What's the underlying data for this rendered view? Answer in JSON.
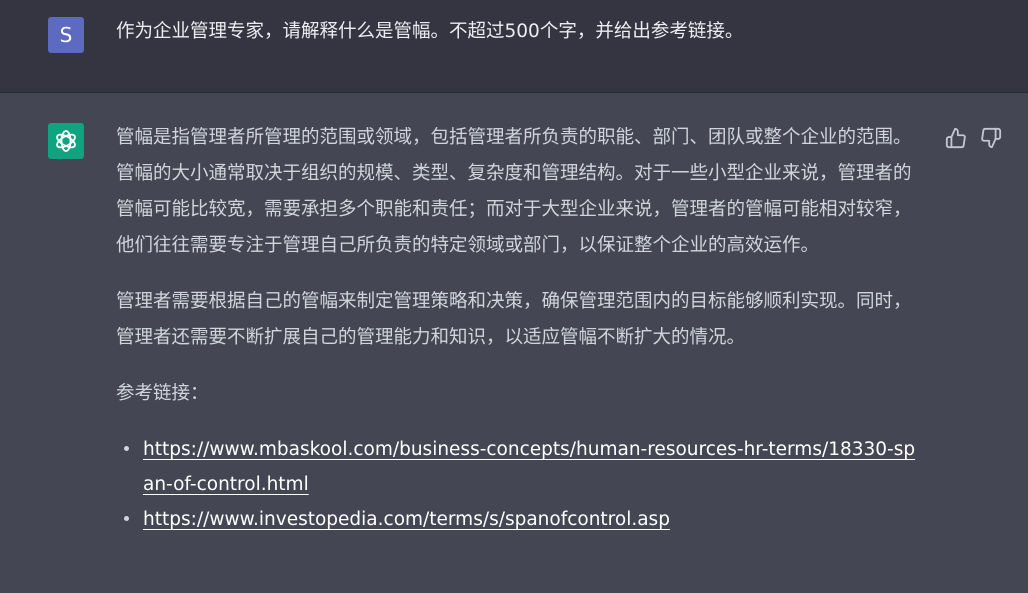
{
  "user_message": {
    "avatar_letter": "S",
    "text": "作为企业管理专家，请解释什么是管幅。不超过500个字，并给出参考链接。"
  },
  "assistant_message": {
    "avatar_icon": "openai-logo-icon",
    "paragraphs": [
      "管幅是指管理者所管理的范围或领域，包括管理者所负责的职能、部门、团队或整个企业的范围。管幅的大小通常取决于组织的规模、类型、复杂度和管理结构。对于一些小型企业来说，管理者的管幅可能比较宽，需要承担多个职能和责任；而对于大型企业来说，管理者的管幅可能相对较窄，他们往往需要专注于管理自己所负责的特定领域或部门，以保证整个企业的高效运作。",
      "管理者需要根据自己的管幅来制定管理策略和决策，确保管理范围内的目标能够顺利实现。同时，管理者还需要不断扩展自己的管理能力和知识，以适应管幅不断扩大的情况。",
      "参考链接："
    ],
    "links": [
      "https://www.mbaskool.com/business-concepts/human-resources-hr-terms/18330-span-of-control.html",
      "https://www.investopedia.com/terms/s/spanofcontrol.asp"
    ]
  },
  "icons": {
    "thumb_up": "thumbs-up-icon",
    "thumb_down": "thumbs-down-icon"
  },
  "colors": {
    "user_bg": "#343541",
    "assistant_bg": "#444654",
    "user_avatar": "#5c6bc0",
    "gpt_avatar": "#10a37f",
    "text": "#d1d5db"
  }
}
